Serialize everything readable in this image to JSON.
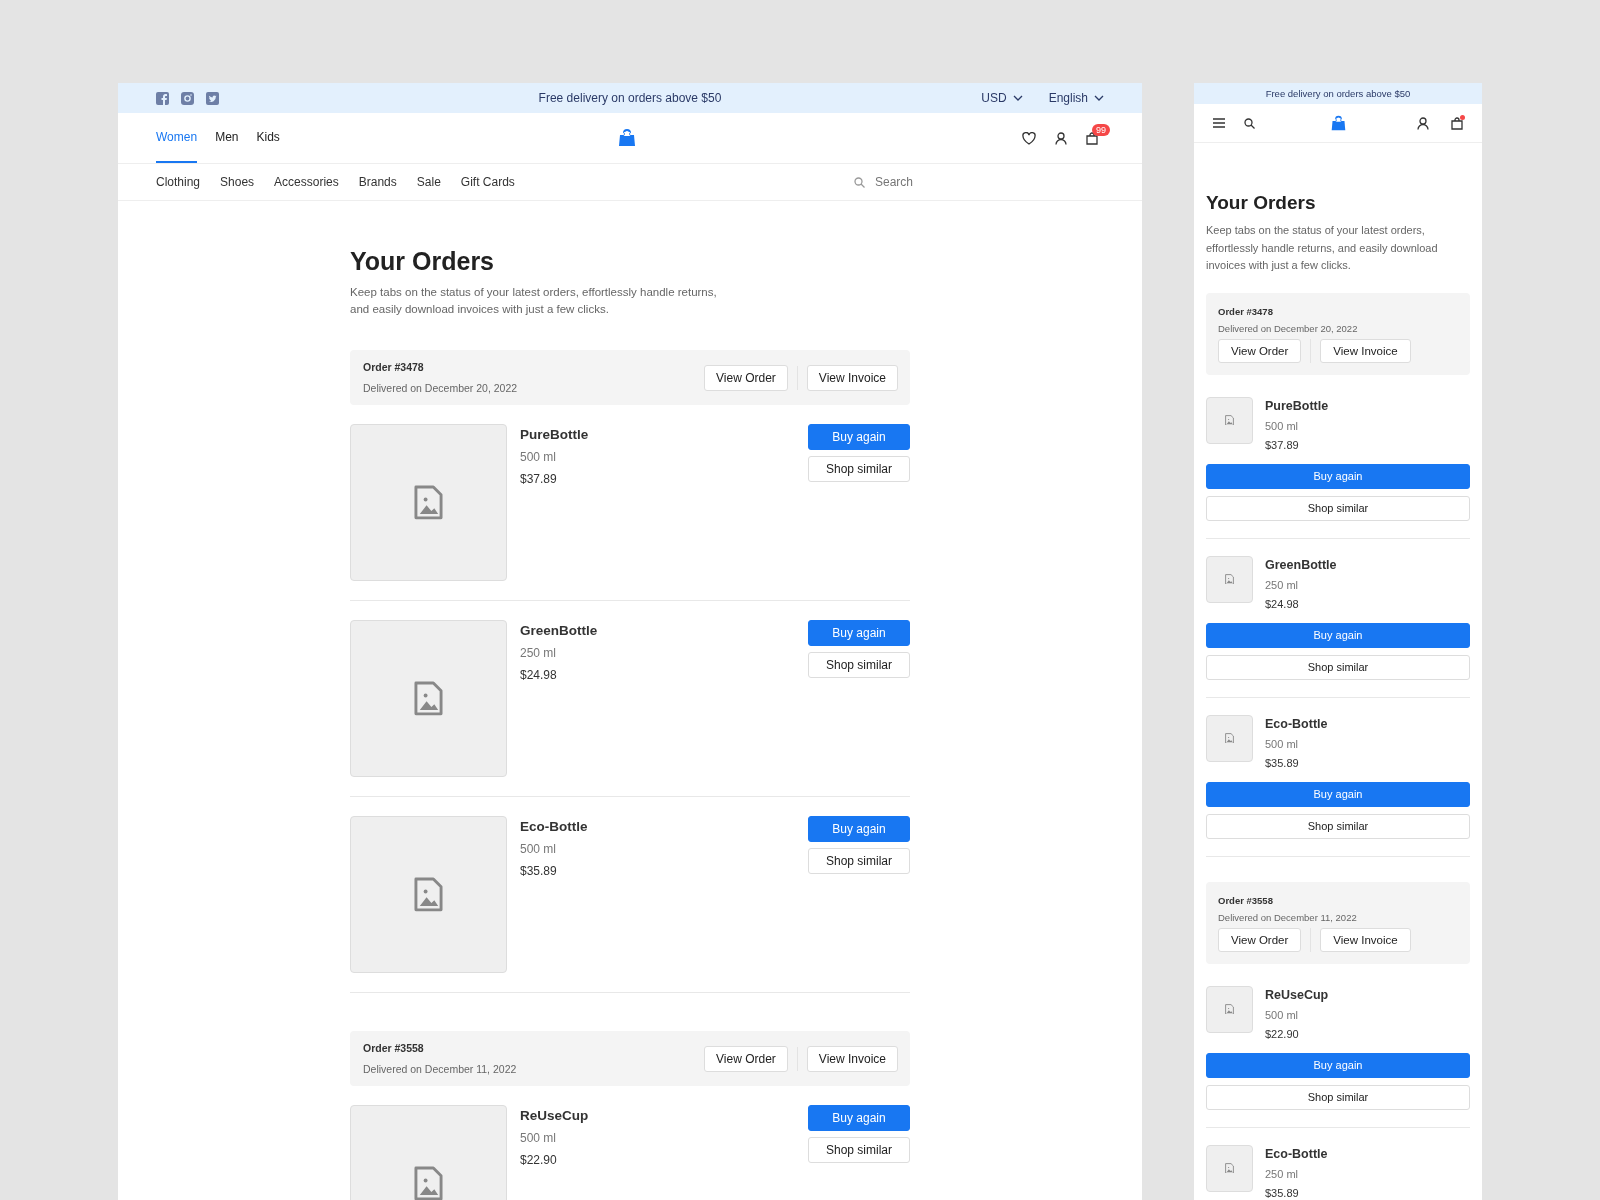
{
  "desktop": {
    "top_bar": {
      "promo": "Free delivery on orders above $50",
      "currency": "USD",
      "language": "English"
    },
    "nav_tabs": [
      {
        "label": "Women",
        "selected": true
      },
      {
        "label": "Men",
        "selected": false
      },
      {
        "label": "Kids",
        "selected": false
      }
    ],
    "cart_badge": "99",
    "categories": [
      "Clothing",
      "Shoes",
      "Accessories",
      "Brands",
      "Sale",
      "Gift Cards"
    ],
    "search": {
      "placeholder": "Search"
    },
    "title": "Your Orders",
    "description": "Keep tabs on the status of your latest orders, effortlessly handle returns, and easily download invoices with just a few clicks.",
    "orders": [
      {
        "number": "Order #3478",
        "status": "Delivered on December 20, 2022",
        "actions": [
          "View Order",
          "View Invoice"
        ],
        "items": [
          {
            "name": "PureBottle",
            "size": "500 ml",
            "price": "$37.89",
            "actions": [
              "Buy again",
              "Shop similar"
            ]
          },
          {
            "name": "GreenBottle",
            "size": "250 ml",
            "price": "$24.98",
            "actions": [
              "Buy again",
              "Shop similar"
            ]
          },
          {
            "name": "Eco-Bottle",
            "size": "500 ml",
            "price": "$35.89",
            "actions": [
              "Buy again",
              "Shop similar"
            ]
          }
        ]
      },
      {
        "number": "Order #3558",
        "status": "Delivered on December 11, 2022",
        "actions": [
          "View Order",
          "View Invoice"
        ],
        "items": [
          {
            "name": "ReUseCup",
            "size": "500 ml",
            "price": "$22.90",
            "actions": [
              "Buy again",
              "Shop similar"
            ]
          }
        ]
      }
    ]
  },
  "mobile": {
    "top_bar": {
      "promo": "Free delivery on orders above $50"
    },
    "cart_dot": true,
    "title": "Your Orders",
    "description": "Keep tabs on the status of your latest orders, effortlessly handle returns, and easily download invoices with just a few clicks.",
    "orders": [
      {
        "number": "Order #3478",
        "status": "Delivered on December 20, 2022",
        "actions": [
          "View Order",
          "View Invoice"
        ],
        "items": [
          {
            "name": "PureBottle",
            "size": "500 ml",
            "price": "$37.89",
            "actions": [
              "Buy again",
              "Shop similar"
            ]
          },
          {
            "name": "GreenBottle",
            "size": "250 ml",
            "price": "$24.98",
            "actions": [
              "Buy again",
              "Shop similar"
            ]
          },
          {
            "name": "Eco-Bottle",
            "size": "500 ml",
            "price": "$35.89",
            "actions": [
              "Buy again",
              "Shop similar"
            ]
          }
        ]
      },
      {
        "number": "Order #3558",
        "status": "Delivered on December 11, 2022",
        "actions": [
          "View Order",
          "View Invoice"
        ],
        "items": [
          {
            "name": "ReUseCup",
            "size": "500 ml",
            "price": "$22.90",
            "actions": [
              "Buy again",
              "Shop similar"
            ]
          },
          {
            "name": "Eco-Bottle",
            "size": "250 ml",
            "price": "$35.89"
          }
        ]
      }
    ]
  }
}
